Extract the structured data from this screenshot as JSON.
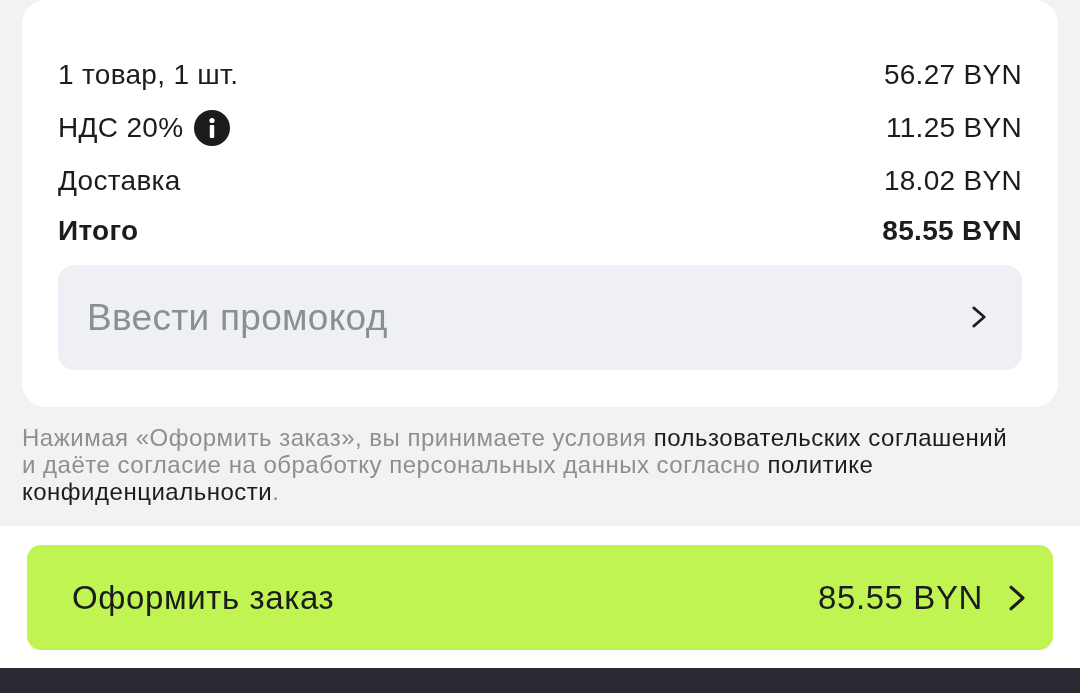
{
  "summary": {
    "rows": [
      {
        "kind": "plain",
        "label": "1 товар, 1 шт.",
        "value": "56.27 BYN"
      },
      {
        "kind": "info",
        "label": "НДС 20%",
        "value": "11.25 BYN"
      },
      {
        "kind": "plain",
        "label": "Доставка",
        "value": "18.02 BYN"
      },
      {
        "kind": "total",
        "label": "Итого",
        "value": "85.55 BYN"
      }
    ]
  },
  "promo": {
    "placeholder": "Ввести промокод"
  },
  "legal": {
    "parts": [
      {
        "kind": "text",
        "text": "Нажимая «Оформить заказ», вы принимаете условия "
      },
      {
        "kind": "link",
        "text": "пользовательских соглашений"
      },
      {
        "kind": "text",
        "text": " и даёте согласие на обработку персональных данных согласно "
      },
      {
        "kind": "link",
        "text": "политике"
      },
      {
        "kind": "link",
        "text": "конфиденциальности"
      },
      {
        "kind": "text",
        "text": "."
      }
    ]
  },
  "checkout": {
    "label": "Оформить заказ",
    "amount": "85.55 BYN"
  }
}
